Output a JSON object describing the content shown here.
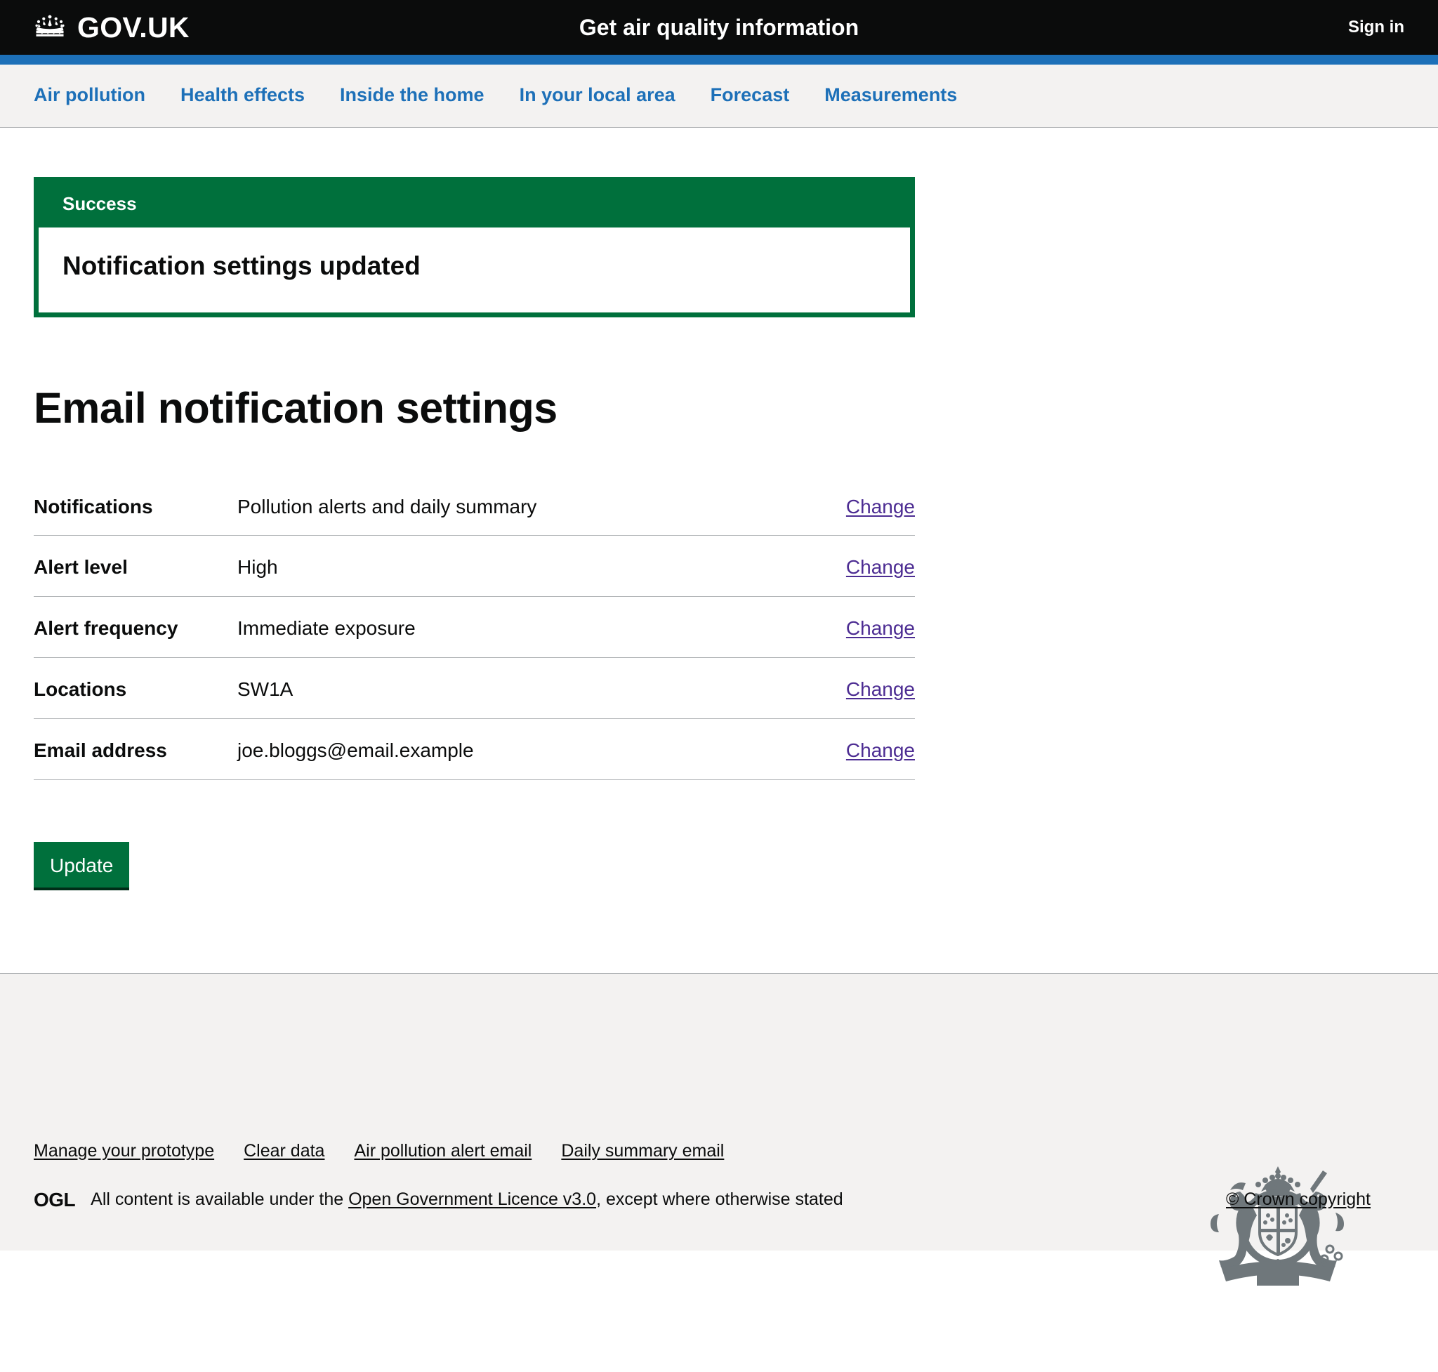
{
  "header": {
    "brand": "GOV.UK",
    "brand_icon": "crown-icon",
    "service_title": "Get air quality information",
    "sign_in": "Sign in",
    "background_color": "#0b0c0c",
    "accent_color": "#1d70b8"
  },
  "nav": {
    "items": [
      {
        "label": "Air pollution"
      },
      {
        "label": "Health effects"
      },
      {
        "label": "Inside the home"
      },
      {
        "label": "In your local area"
      },
      {
        "label": "Forecast"
      },
      {
        "label": "Measurements"
      }
    ],
    "link_color": "#1d70b8"
  },
  "notification_banner": {
    "title": "Success",
    "message": "Notification settings updated",
    "color": "#00703c"
  },
  "page": {
    "title": "Email notification settings"
  },
  "summary": {
    "change_label": "Change",
    "link_color": "#4c2c92",
    "rows": [
      {
        "key": "Notifications",
        "value": "Pollution alerts and daily summary",
        "action": "Change"
      },
      {
        "key": "Alert level",
        "value": "High",
        "action": "Change"
      },
      {
        "key": "Alert frequency",
        "value": "Immediate exposure",
        "action": "Change"
      },
      {
        "key": "Locations",
        "value": "SW1A",
        "action": "Change"
      },
      {
        "key": "Email address",
        "value": "joe.bloggs@email.example",
        "action": "Change"
      }
    ]
  },
  "actions": {
    "update_label": "Update",
    "update_color": "#00703c"
  },
  "footer": {
    "links": [
      {
        "label": "Manage your prototype"
      },
      {
        "label": "Clear data"
      },
      {
        "label": "Air pollution alert email"
      },
      {
        "label": "Daily summary email"
      }
    ],
    "ogl_logo": "OGL",
    "licence_prefix": "All content is available under the",
    "licence_link": "Open Government Licence v3.0",
    "licence_suffix": ", except where otherwise stated",
    "crown_copyright": "© Crown copyright",
    "crest_icon": "royal-coat-of-arms-icon",
    "background_color": "#f3f2f1"
  }
}
